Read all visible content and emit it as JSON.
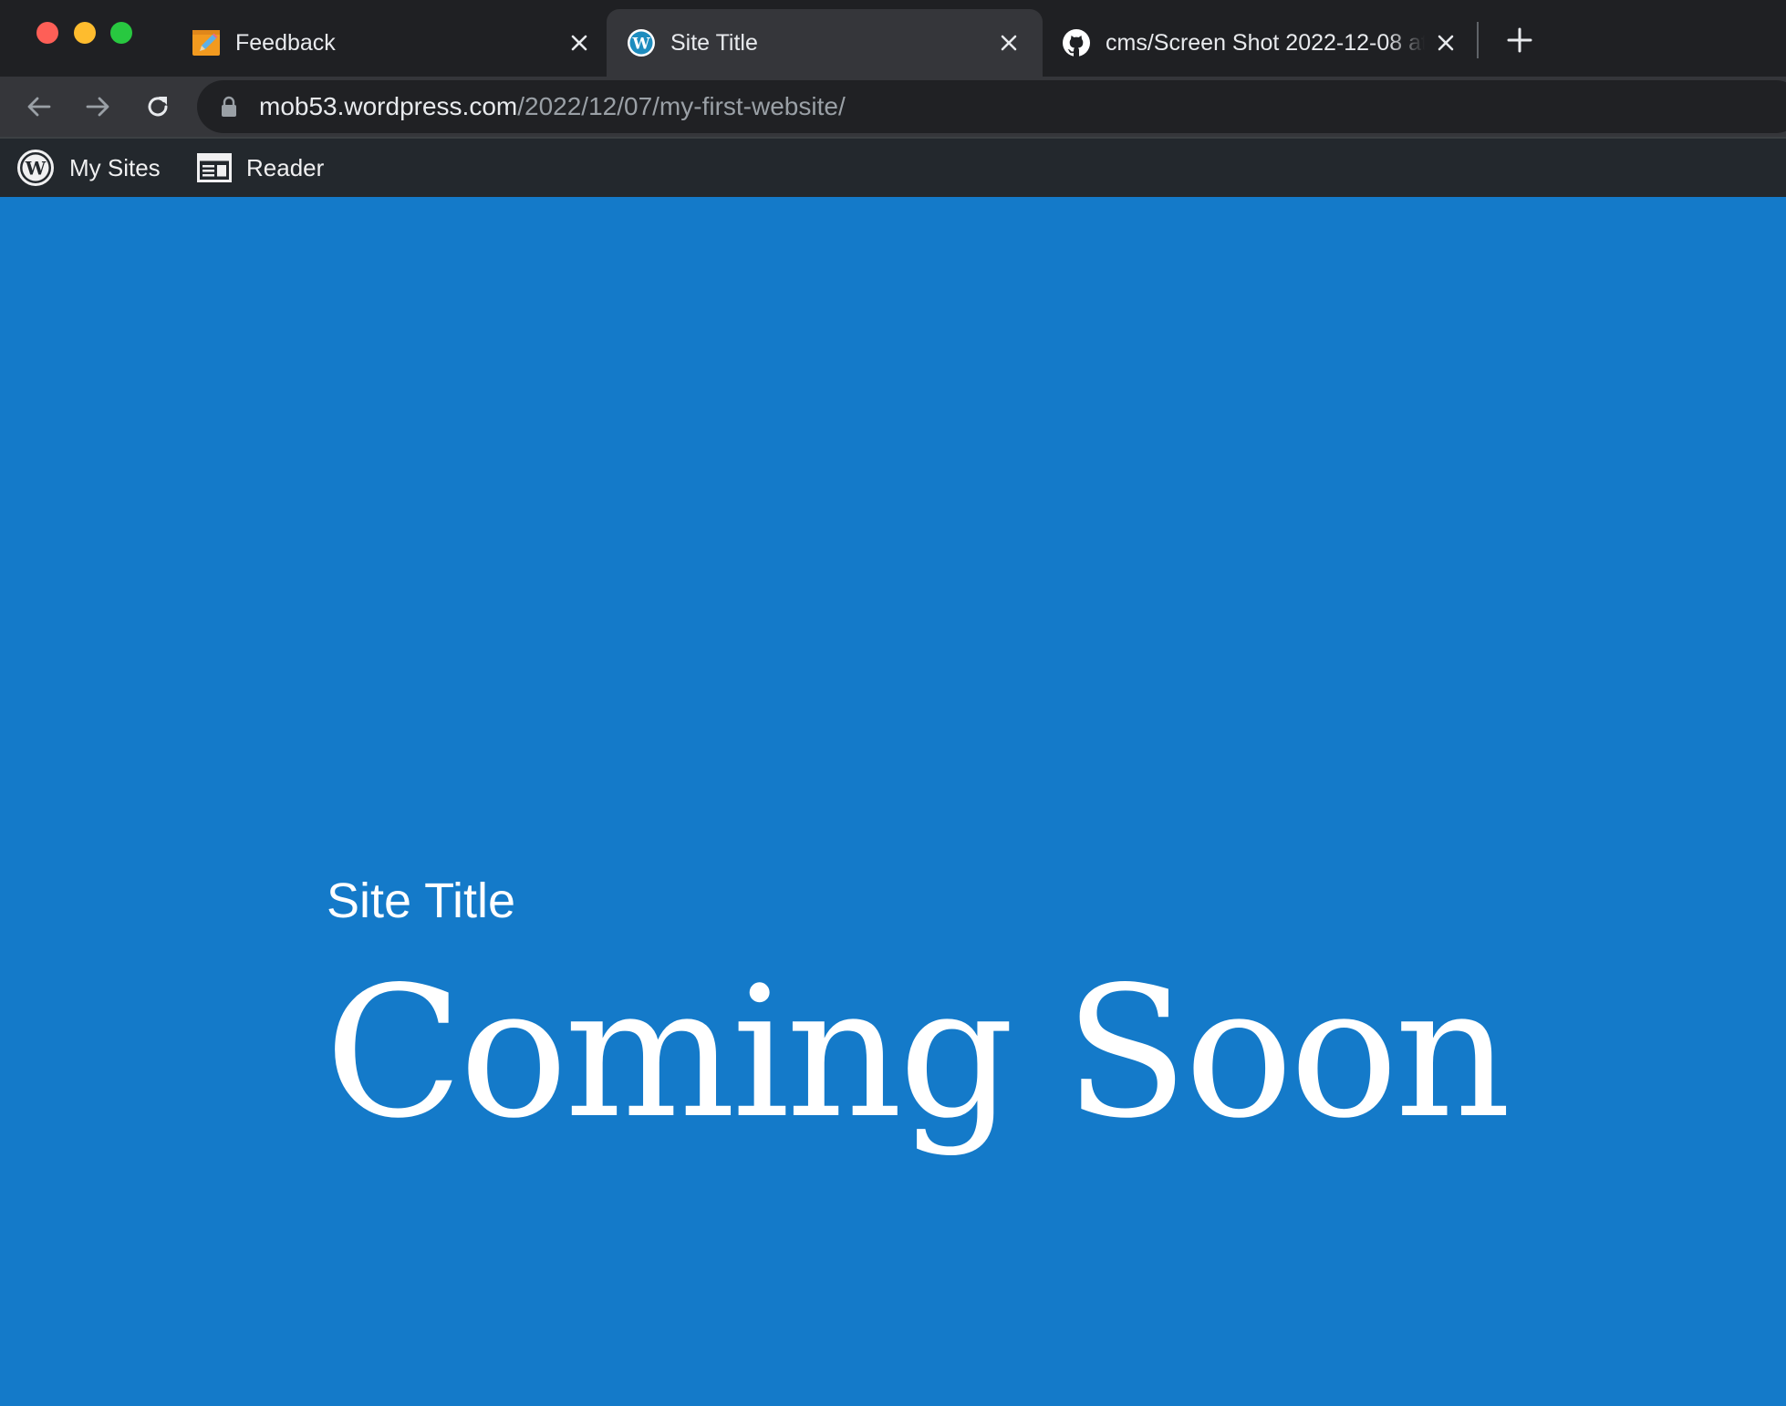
{
  "browser": {
    "tabs": [
      {
        "title": "Feedback",
        "icon": "pencil-notepad-icon",
        "active": false
      },
      {
        "title": "Site Title",
        "icon": "wordpress-icon",
        "active": true
      },
      {
        "title": "cms/Screen Shot 2022-12-08 at",
        "icon": "github-icon",
        "active": false
      }
    ],
    "address": {
      "host": "mob53.wordpress.com",
      "path": "/2022/12/07/my-first-website/"
    }
  },
  "admin_bar": {
    "my_sites_label": "My Sites",
    "reader_label": "Reader"
  },
  "page": {
    "site_title": "Site Title",
    "headline": "Coming Soon",
    "background_color": "#147ac9"
  },
  "colors": {
    "tab_strip": "#1f2023",
    "active_tab": "#35363a",
    "admin_bar": "#23282d"
  }
}
